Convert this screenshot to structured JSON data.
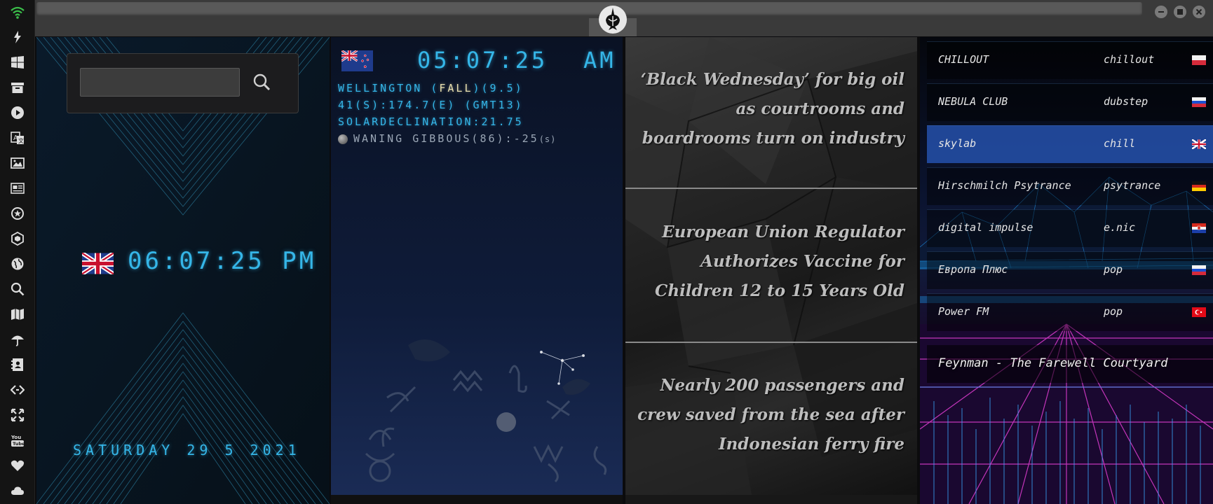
{
  "rail": {
    "icons": [
      "wifi-icon",
      "lightning-icon",
      "windows-icon",
      "archive-icon",
      "play-icon",
      "translate-icon",
      "image-icon",
      "news-icon",
      "settings-badge-icon",
      "hexagon-icon",
      "globe-icon",
      "search-icon",
      "map-icon",
      "umbrella-icon",
      "contacts-icon",
      "code-icon",
      "expand-icon",
      "youtube-icon",
      "heart-icon",
      "cloud-icon"
    ],
    "accent": "#3bbf4a"
  },
  "topbar": {
    "logo": "rebel-alliance-icon",
    "window_buttons": [
      "minimize-icon",
      "maximize-icon",
      "close-icon"
    ]
  },
  "search": {
    "value": "",
    "placeholder": ""
  },
  "local_clock": {
    "flag": "uk-flag",
    "time": "06:07:25 PM",
    "date": "SATURDAY 29 5 2021"
  },
  "world_clock": {
    "flag": "nz-flag",
    "time": "05:07:25",
    "ampm": "AM",
    "city_prefix": "WELLINGTON (",
    "season": "FALL",
    "city_suffix": ")(9.5)",
    "coords": "41(S):174.7(E) (GMT13)",
    "declination": "SOLARDECLINATION:21.75",
    "moon": "WANING GIBBOUS(86):-25",
    "moon_unit": "(s)"
  },
  "news": [
    "‘Black Wednesday’ for big oil as courtrooms and boardrooms turn on industry",
    "European Union Regulator Authorizes Vaccine for Children 12 to 15 Years Old",
    "Nearly 200 passengers and crew saved from the sea after Indonesian ferry fire"
  ],
  "radio": {
    "stations": [
      {
        "name": "CHILLOUT",
        "genre": "chillout",
        "flag": "poland-flag",
        "active": false
      },
      {
        "name": "NEBULA CLUB",
        "genre": "dubstep",
        "flag": "russia-flag",
        "active": false
      },
      {
        "name": "skylab",
        "genre": "chill",
        "flag": "uk-flag",
        "active": true
      },
      {
        "name": "Hirschmilch Psytrance",
        "genre": "psytrance",
        "flag": "germany-flag",
        "active": false
      },
      {
        "name": "digital impulse",
        "genre": "e.nic",
        "flag": "croatia-flag",
        "active": false
      },
      {
        "name": "Европа Плюс",
        "genre": "pop",
        "flag": "russia-flag",
        "active": false
      },
      {
        "name": "Power FM",
        "genre": "pop",
        "flag": "turkey-flag",
        "active": false
      }
    ],
    "now_playing": "Feynman - The Farewell Courtyard",
    "active_color": "#2f62c4"
  }
}
